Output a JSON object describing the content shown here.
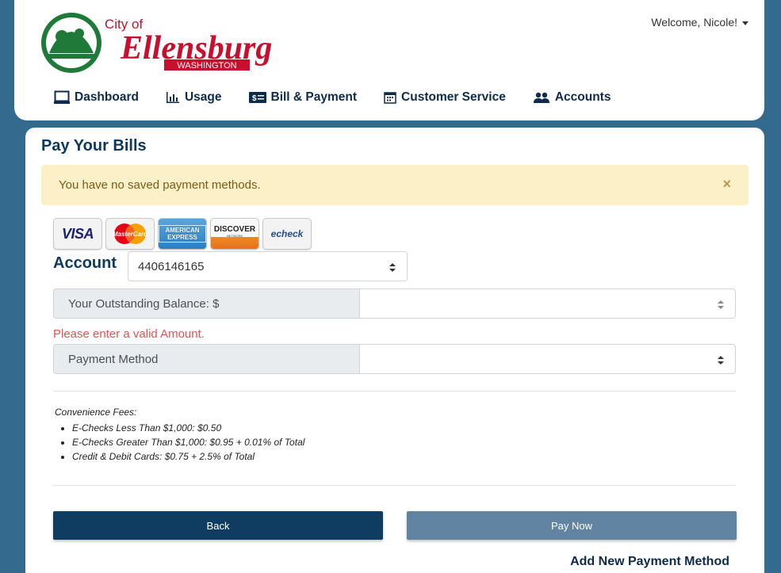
{
  "header": {
    "logo": {
      "city_of": "City of",
      "name": "Ellensburg",
      "state": "WASHINGTON"
    },
    "welcome": "Welcome, Nicole!",
    "nav": [
      {
        "label": "Dashboard",
        "icon": "monitor-icon"
      },
      {
        "label": "Usage",
        "icon": "bar-chart-icon"
      },
      {
        "label": "Bill & Payment",
        "icon": "money-bill-icon"
      },
      {
        "label": "Customer Service",
        "icon": "calendar-icon"
      },
      {
        "label": "Accounts",
        "icon": "users-icon"
      }
    ]
  },
  "main": {
    "title": "Pay Your Bills",
    "alert": {
      "text": "You have no saved payment methods.",
      "close": "×"
    },
    "payment_logos": {
      "visa": "VISA",
      "mastercard": "MasterCard",
      "amex": "AMERICAN EXPRESS",
      "discover": "DISCOVER",
      "discover_sub": "NETWORK",
      "echeck": "echeck"
    },
    "account": {
      "label": "Account",
      "value": "4406146165"
    },
    "balance": {
      "label": "Your Outstanding Balance: $",
      "value": ""
    },
    "error": "Please enter a valid Amount.",
    "payment_method": {
      "label": "Payment Method",
      "value": ""
    },
    "fees": {
      "heading": "Convenience Fees:",
      "items": [
        "E-Checks Less Than $1,000: $0.50",
        "E-Checks Greater Than $1,000: $0.95 + 0.01% of Total",
        "Credit & Debit Cards: $0.75 + 2.5% of Total"
      ]
    },
    "buttons": {
      "back": "Back",
      "pay_now": "Pay Now"
    },
    "add_method": "Add New Payment Method"
  },
  "colors": {
    "background": "#356a8f",
    "primary_dark": "#0f3d61",
    "pay_button": "#6184a2",
    "alert_bg": "#fcf0c9",
    "error": "#e05454",
    "logo_green": "#1f7a3a",
    "logo_red": "#c8102e"
  }
}
